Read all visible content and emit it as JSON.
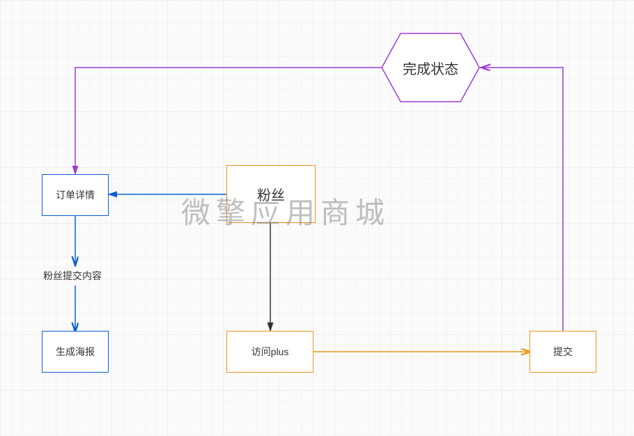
{
  "nodes": {
    "complete_status": {
      "label": "完成状态"
    },
    "order_details": {
      "label": "订单详情"
    },
    "fans": {
      "label": "粉丝"
    },
    "generate_poster": {
      "label": "生成海报"
    },
    "visit_plus": {
      "label": "访问plus"
    },
    "submit": {
      "label": "提交"
    }
  },
  "labels": {
    "fans_submit_content": "粉丝提交内容"
  },
  "watermark": "微擎应用商城",
  "colors": {
    "purple": "#9b3dd6",
    "blue": "#0b5cd6",
    "orange": "#f09219",
    "black": "#333333"
  }
}
